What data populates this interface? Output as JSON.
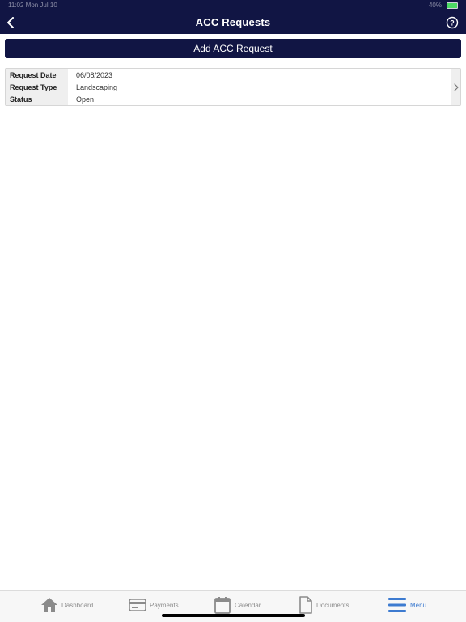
{
  "status_bar": {
    "time": "11:02  Mon Jul 10",
    "signal": "40%"
  },
  "header": {
    "title": "ACC Requests",
    "back_icon": "chevron-left-icon",
    "help_icon": "question-circle-icon"
  },
  "actions": {
    "add_label": "Add ACC Request"
  },
  "requests": [
    {
      "date_label": "Request Date",
      "date_value": "06/08/2023",
      "type_label": "Request Type",
      "type_value": "Landscaping",
      "status_label": "Status",
      "status_value": "Open"
    }
  ],
  "tabbar": {
    "tabs": [
      {
        "label": "Dashboard",
        "icon": "home-icon"
      },
      {
        "label": "Payments",
        "icon": "credit-card-icon"
      },
      {
        "label": "Calendar",
        "icon": "calendar-icon"
      },
      {
        "label": "Documents",
        "icon": "document-icon"
      },
      {
        "label": "Menu",
        "icon": "menu-icon",
        "active": true
      }
    ]
  },
  "colors": {
    "header_bg": "#111544",
    "button_bg": "#111544",
    "active_tab": "#3d7bd0",
    "inactive_tab": "#8b8b8b"
  }
}
